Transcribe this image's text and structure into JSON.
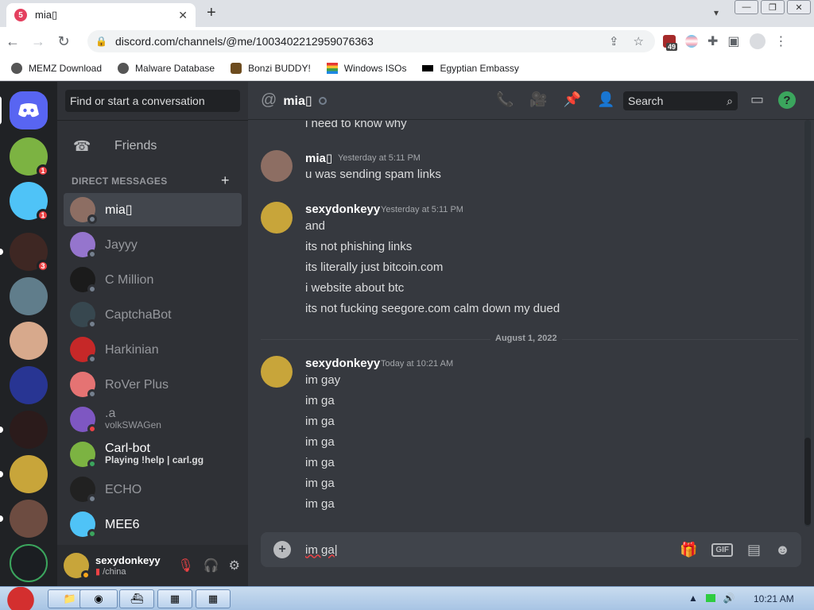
{
  "browser": {
    "tab_title": "mia▯",
    "favicon_badge": "5",
    "url": "discord.com/channels/@me/1003402212959076363",
    "extension_badge": "49",
    "bookmarks": [
      {
        "label": "MEMZ Download"
      },
      {
        "label": "Malware Database"
      },
      {
        "label": "Bonzi BUDDY!"
      },
      {
        "label": "Windows ISOs"
      },
      {
        "label": "Egyptian Embassy"
      }
    ]
  },
  "servers": {
    "badges": [
      "1",
      "1",
      "3"
    ]
  },
  "sidebar": {
    "search_placeholder": "Find or start a conversation",
    "friends_label": "Friends",
    "dm_header": "DIRECT MESSAGES",
    "dms": [
      {
        "name": "mia▯",
        "sub": "",
        "color": "#8d6e63",
        "status": "idle"
      },
      {
        "name": "Jayyy",
        "sub": "",
        "color": "#9575cd",
        "status": "idle"
      },
      {
        "name": "C Million",
        "sub": "",
        "color": "#1b1b1b",
        "status": "idle"
      },
      {
        "name": "CaptchaBot",
        "sub": "",
        "color": "#37474f",
        "status": "idle"
      },
      {
        "name": "Harkinian",
        "sub": "",
        "color": "#c62828",
        "status": "idle"
      },
      {
        "name": "RoVer Plus",
        "sub": "",
        "color": "#e57373",
        "status": "idle"
      },
      {
        "name": ".a",
        "sub": "volkSWAGen",
        "color": "#7e57c2",
        "status": "dnd"
      },
      {
        "name": "Carl-bot",
        "sub": "Playing !help | carl.gg",
        "color": "#7cb342",
        "status": "on"
      },
      {
        "name": "ECHO",
        "sub": "",
        "color": "#212121",
        "status": "idle"
      },
      {
        "name": "MEE6",
        "sub": "",
        "color": "#4fc3f7",
        "status": "on"
      }
    ]
  },
  "user": {
    "name": "sexydonkeyy",
    "status": "/china"
  },
  "chat": {
    "channel_name": "mia▯",
    "search_label": "Search",
    "composer_text": "im ga",
    "messages_top": "i need to know why",
    "group1": {
      "author": "mia▯",
      "time": "Yesterday at 5:11 PM",
      "lines": [
        "u was sending spam links"
      ]
    },
    "group2": {
      "author": "sexydonkeyy",
      "time": "Yesterday at 5:11 PM",
      "lines": [
        "and",
        "its not phishing links",
        "its literally just bitcoin.com",
        "i website about btc",
        "its not fucking seegore.com calm down my dued"
      ]
    },
    "divider": "August 1, 2022",
    "group3": {
      "author": "sexydonkeyy",
      "time": "Today at 10:21 AM",
      "lines": [
        "im gay",
        "im ga",
        "im ga",
        "im ga",
        "im ga",
        "im ga",
        "im ga"
      ]
    }
  },
  "taskbar": {
    "clock": "10:21 AM"
  },
  "colors": {
    "discord_bg": "#36393f",
    "blurple": "#5865f2",
    "online": "#3ba55d",
    "dnd": "#ed4245"
  }
}
